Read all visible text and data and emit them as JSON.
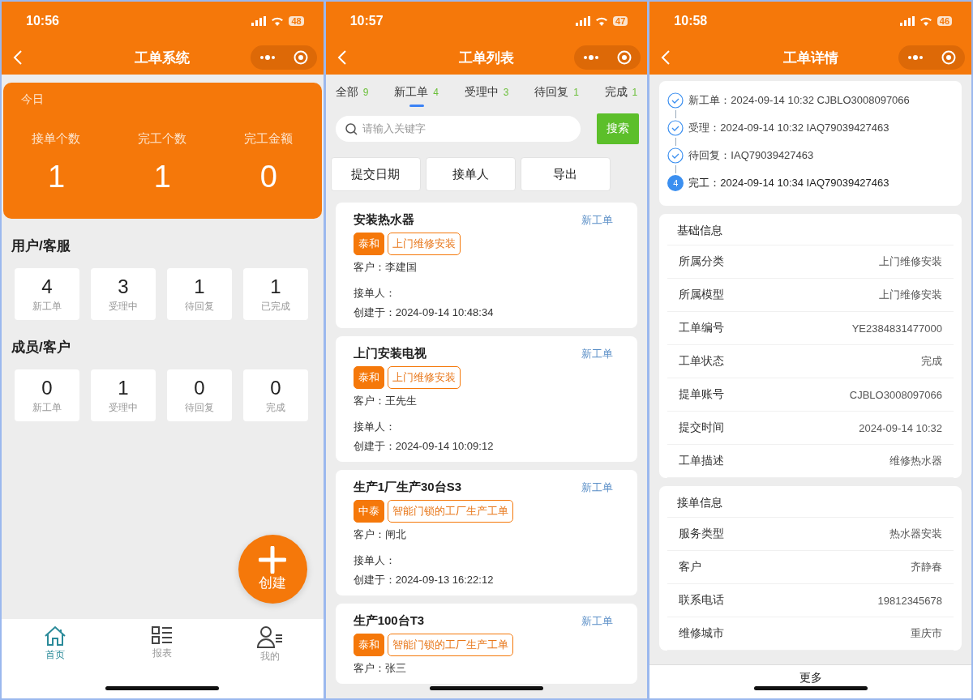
{
  "screens": [
    {
      "kind": "home",
      "status": {
        "time": "10:56",
        "battery": "48"
      },
      "title": "工单系统",
      "today": {
        "label": "今日",
        "stats": [
          {
            "label": "接单个数",
            "value": "1"
          },
          {
            "label": "完工个数",
            "value": "1"
          },
          {
            "label": "完工金额",
            "value": "0"
          }
        ]
      },
      "groups": [
        {
          "title": "用户/客服",
          "tiles": [
            {
              "value": "4",
              "label": "新工单"
            },
            {
              "value": "3",
              "label": "受理中"
            },
            {
              "value": "1",
              "label": "待回复"
            },
            {
              "value": "1",
              "label": "已完成"
            }
          ]
        },
        {
          "title": "成员/客户",
          "tiles": [
            {
              "value": "0",
              "label": "新工单"
            },
            {
              "value": "1",
              "label": "受理中"
            },
            {
              "value": "0",
              "label": "待回复"
            },
            {
              "value": "0",
              "label": "完成"
            }
          ]
        }
      ],
      "fab": "创建",
      "tabbar": [
        {
          "label": "首页",
          "selected": true
        },
        {
          "label": "报表",
          "selected": false
        },
        {
          "label": "我的",
          "selected": false
        }
      ]
    },
    {
      "kind": "list",
      "status": {
        "time": "10:57",
        "battery": "47"
      },
      "title": "工单列表",
      "tabs": [
        {
          "label": "全部",
          "count": "9",
          "selected": false
        },
        {
          "label": "新工单",
          "count": "4",
          "selected": true
        },
        {
          "label": "受理中",
          "count": "3",
          "selected": false
        },
        {
          "label": "待回复",
          "count": "1",
          "selected": false
        },
        {
          "label": "完成",
          "count": "1",
          "selected": false
        }
      ],
      "search": {
        "placeholder": "请输入关键字",
        "button": "搜索"
      },
      "filters": [
        "提交日期",
        "接单人",
        "导出"
      ],
      "cards": [
        {
          "title": "安装热水器",
          "status": "新工单",
          "tags": [
            "泰和",
            "上门维修安装"
          ],
          "customer": "客户：李建国",
          "assignee": "接单人：",
          "created": "创建于：2024-09-14 10:48:34"
        },
        {
          "title": "上门安装电视",
          "status": "新工单",
          "tags": [
            "泰和",
            "上门维修安装"
          ],
          "customer": "客户：王先生",
          "assignee": "接单人：",
          "created": "创建于：2024-09-14 10:09:12"
        },
        {
          "title": "生产1厂生产30台S3",
          "status": "新工单",
          "tags": [
            "中泰",
            "智能门锁的工厂生产工单"
          ],
          "customer": "客户：闸北",
          "assignee": "接单人：",
          "created": "创建于：2024-09-13 16:22:12"
        },
        {
          "title": "生产100台T3",
          "status": "新工单",
          "tags": [
            "泰和",
            "智能门锁的工厂生产工单"
          ],
          "customer": "客户：张三"
        }
      ]
    },
    {
      "kind": "detail",
      "status": {
        "time": "10:58",
        "battery": "46"
      },
      "title": "工单详情",
      "timeline": [
        {
          "text": "新工单：2024-09-14 10:32 CJBLO3008097066",
          "done": true
        },
        {
          "text": "受理：2024-09-14 10:32 IAQ79039427463",
          "done": true
        },
        {
          "text": "待回复：IAQ79039427463",
          "done": true
        },
        {
          "text": "完工：2024-09-14 10:34 IAQ79039427463",
          "done": false,
          "number": "4"
        }
      ],
      "sections": [
        {
          "title": "基础信息",
          "rows": [
            {
              "label": "所属分类",
              "value": "上门维修安装"
            },
            {
              "label": "所属模型",
              "value": "上门维修安装"
            },
            {
              "label": "工单编号",
              "value": "YE2384831477000"
            },
            {
              "label": "工单状态",
              "value": "完成"
            },
            {
              "label": "提单账号",
              "value": "CJBLO3008097066"
            },
            {
              "label": "提交时间",
              "value": "2024-09-14 10:32"
            },
            {
              "label": "工单描述",
              "value": "维修热水器"
            }
          ]
        },
        {
          "title": "接单信息",
          "rows": [
            {
              "label": "服务类型",
              "value": "热水器安装"
            },
            {
              "label": "客户",
              "value": "齐静春"
            },
            {
              "label": "联系电话",
              "value": "19812345678"
            },
            {
              "label": "维修城市",
              "value": "重庆市"
            }
          ]
        }
      ],
      "footer": "更多"
    }
  ]
}
